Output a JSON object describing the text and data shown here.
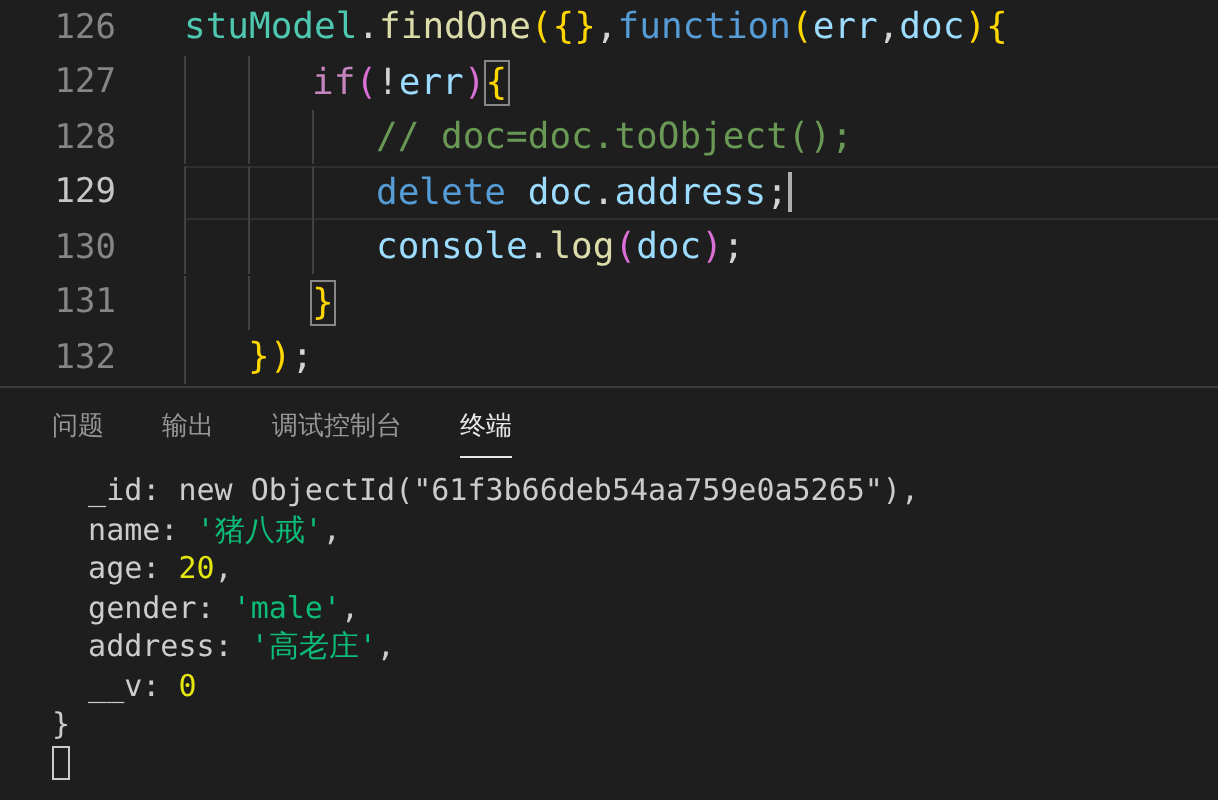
{
  "editor": {
    "lines": [
      {
        "number": "126",
        "current": false,
        "tokens": [
          {
            "kind": "type",
            "text": "stuModel"
          },
          {
            "kind": "punct",
            "text": "."
          },
          {
            "kind": "func",
            "text": "findOne"
          },
          {
            "kind": "bracket",
            "text": "({}"
          },
          {
            "kind": "punct",
            "text": ","
          },
          {
            "kind": "keyword",
            "text": "function"
          },
          {
            "kind": "bracket",
            "text": "("
          },
          {
            "kind": "param",
            "text": "err"
          },
          {
            "kind": "punct",
            "text": ","
          },
          {
            "kind": "param",
            "text": "doc"
          },
          {
            "kind": "bracket",
            "text": "){"
          }
        ]
      },
      {
        "number": "127",
        "current": false,
        "tokens": [
          {
            "kind": "control",
            "text": "        if"
          },
          {
            "kind": "bracket2",
            "text": "("
          },
          {
            "kind": "punct",
            "text": "!"
          },
          {
            "kind": "param",
            "text": "err"
          },
          {
            "kind": "bracket2",
            "text": ")"
          },
          {
            "kind": "match",
            "text": "{"
          }
        ]
      },
      {
        "number": "128",
        "current": false,
        "tokens": [
          {
            "kind": "comment",
            "text": "            // doc=doc.toObject();"
          }
        ]
      },
      {
        "number": "129",
        "current": true,
        "tokens": [
          {
            "kind": "keyword",
            "text": "            delete "
          },
          {
            "kind": "param",
            "text": "doc"
          },
          {
            "kind": "punct",
            "text": "."
          },
          {
            "kind": "param",
            "text": "address"
          },
          {
            "kind": "punct",
            "text": ";"
          }
        ]
      },
      {
        "number": "130",
        "current": false,
        "tokens": [
          {
            "kind": "param",
            "text": "            console"
          },
          {
            "kind": "punct",
            "text": "."
          },
          {
            "kind": "func",
            "text": "log"
          },
          {
            "kind": "bracket2",
            "text": "("
          },
          {
            "kind": "param",
            "text": "doc"
          },
          {
            "kind": "bracket2",
            "text": ")"
          },
          {
            "kind": "punct",
            "text": ";"
          }
        ]
      },
      {
        "number": "131",
        "current": false,
        "tokens": [
          {
            "kind": "match",
            "text": "        }"
          }
        ]
      },
      {
        "number": "132",
        "current": false,
        "tokens": [
          {
            "kind": "bracket",
            "text": "    })"
          },
          {
            "kind": "punct",
            "text": ";"
          }
        ]
      }
    ]
  },
  "panel": {
    "tabs": [
      {
        "label": "问题",
        "selected": false
      },
      {
        "label": "输出",
        "selected": false
      },
      {
        "label": "调试控制台",
        "selected": false
      },
      {
        "label": "终端",
        "selected": true
      }
    ],
    "terminal": [
      {
        "tokens": [
          {
            "kind": "plain",
            "text": "  _id: new ObjectId(\"61f3b66deb54aa759e0a5265\"),"
          }
        ]
      },
      {
        "tokens": [
          {
            "kind": "plain",
            "text": "  name: "
          },
          {
            "kind": "string",
            "text": "'猪八戒'"
          },
          {
            "kind": "plain",
            "text": ","
          }
        ]
      },
      {
        "tokens": [
          {
            "kind": "plain",
            "text": "  age: "
          },
          {
            "kind": "number",
            "text": "20"
          },
          {
            "kind": "plain",
            "text": ","
          }
        ]
      },
      {
        "tokens": [
          {
            "kind": "plain",
            "text": "  gender: "
          },
          {
            "kind": "string",
            "text": "'male'"
          },
          {
            "kind": "plain",
            "text": ","
          }
        ]
      },
      {
        "tokens": [
          {
            "kind": "plain",
            "text": "  address: "
          },
          {
            "kind": "string",
            "text": "'高老庄'"
          },
          {
            "kind": "plain",
            "text": ","
          }
        ]
      },
      {
        "tokens": [
          {
            "kind": "plain",
            "text": "  __v: "
          },
          {
            "kind": "number",
            "text": "0"
          }
        ]
      },
      {
        "tokens": [
          {
            "kind": "plain",
            "text": "}"
          }
        ]
      }
    ]
  }
}
